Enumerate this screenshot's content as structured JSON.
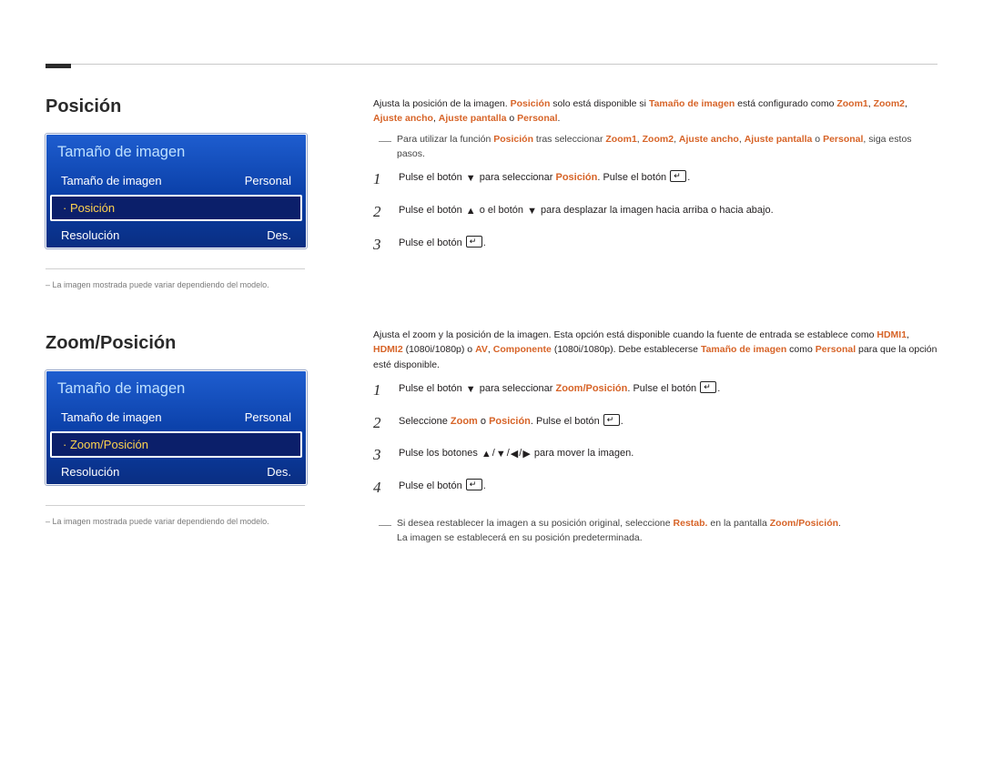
{
  "section1": {
    "title": "Posición",
    "menu": {
      "header": "Tamaño de imagen",
      "row1_label": "Tamaño de imagen",
      "row1_value": "Personal",
      "selected": "Posición",
      "row3_label": "Resolución",
      "row3_value": "Des."
    },
    "disclaimer": "La imagen mostrada puede variar dependiendo del modelo.",
    "intro_pre": "Ajusta la posición de la imagen. ",
    "intro_hl1": "Posición",
    "intro_mid1": " solo está disponible si ",
    "intro_hl2": "Tamaño de imagen",
    "intro_mid2": " está configurado como ",
    "intro_hl3": "Zoom1",
    "intro_sep1": ", ",
    "intro_hl4": "Zoom2",
    "intro_sep2": ", ",
    "intro_hl5": "Ajuste ancho",
    "intro_sep3": ", ",
    "intro_hl6": "Ajuste pantalla",
    "intro_sep4": " o ",
    "intro_hl7": "Personal",
    "intro_end": ".",
    "note_pre": "Para utilizar la función ",
    "note_hl1": "Posición",
    "note_mid1": " tras seleccionar ",
    "note_hl2": "Zoom1",
    "note_sep1": ", ",
    "note_hl3": "Zoom2",
    "note_sep2": ", ",
    "note_hl4": "Ajuste ancho",
    "note_sep3": ", ",
    "note_hl5": "Ajuste pantalla",
    "note_sep4": " o ",
    "note_hl6": "Personal",
    "note_end": ", siga estos pasos.",
    "step1_pre": "Pulse el botón ",
    "step1_mid": " para seleccionar ",
    "step1_hl": "Posición",
    "step1_mid2": ". Pulse el botón ",
    "step1_end": ".",
    "step2_pre": "Pulse el botón ",
    "step2_mid": " o el botón ",
    "step2_end": " para desplazar la imagen hacia arriba o hacia abajo.",
    "step3_pre": "Pulse el botón ",
    "step3_end": "."
  },
  "section2": {
    "title": "Zoom/Posición",
    "menu": {
      "header": "Tamaño de imagen",
      "row1_label": "Tamaño de imagen",
      "row1_value": "Personal",
      "selected": "Zoom/Posición",
      "row3_label": "Resolución",
      "row3_value": "Des."
    },
    "disclaimer": "La imagen mostrada puede variar dependiendo del modelo.",
    "intro_pre": "Ajusta el zoom y la posición de la imagen. Esta opción está disponible cuando la fuente de entrada se establece como ",
    "intro_hl1": "HDMI1",
    "intro_sep1": ", ",
    "intro_hl2": "HDMI2",
    "intro_mid1": " (1080i/1080p) o ",
    "intro_hl3": "AV",
    "intro_sep2": ", ",
    "intro_hl4": "Componente",
    "intro_mid2": " (1080i/1080p). Debe establecerse ",
    "intro_hl5": "Tamaño de imagen",
    "intro_mid3": " como ",
    "intro_hl6": "Personal",
    "intro_end": " para que la opción esté disponible.",
    "step1_pre": "Pulse el botón ",
    "step1_mid": " para seleccionar ",
    "step1_hl": "Zoom/Posición",
    "step1_mid2": ". Pulse el botón ",
    "step1_end": ".",
    "step2_pre": "Seleccione ",
    "step2_hl1": "Zoom",
    "step2_sep": " o ",
    "step2_hl2": "Posición",
    "step2_mid": ". Pulse el botón ",
    "step2_end": ".",
    "step3_pre": "Pulse los botones ",
    "step3_end": " para mover la imagen.",
    "step4_pre": "Pulse el botón ",
    "step4_end": ".",
    "note_pre": "Si desea restablecer la imagen a su posición original, seleccione ",
    "note_hl1": "Restab.",
    "note_mid1": " en la pantalla ",
    "note_hl2": "Zoom/Posición",
    "note_end": ".",
    "note_line2": "La imagen se establecerá en su posición predeterminada."
  }
}
